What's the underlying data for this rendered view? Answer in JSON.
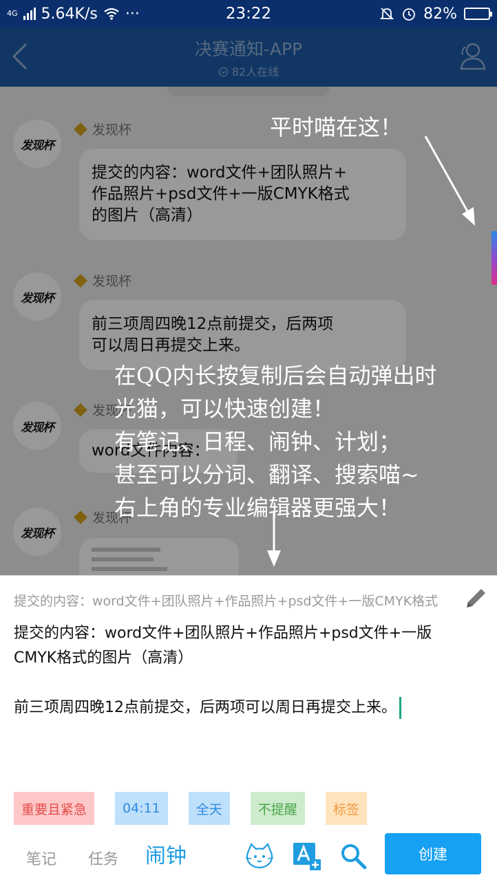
{
  "status_bar": {
    "network": "4G",
    "speed": "5.64K/s",
    "more": "···",
    "time": "23:22",
    "battery": "82%",
    "battery_level": 0.82
  },
  "header": {
    "title": "决赛通知-APP",
    "online": "82人在线"
  },
  "chat": {
    "messages": [
      {
        "sender": "发现杯",
        "avatar_text": "发现杯",
        "lines": [
          "提交的内容：word文件+团队照片+",
          "作品照片+psd文件+一版CMYK格式",
          "的图片（高清）"
        ]
      },
      {
        "sender": "发现杯",
        "avatar_text": "发现杯",
        "lines": [
          "前三项周四晚12点前提交，后两项",
          "可以周日再提交上来。"
        ]
      },
      {
        "sender": "发现杯",
        "avatar_text": "发现杯",
        "lines": [
          "word文件内容："
        ]
      },
      {
        "sender": "发现杯",
        "avatar_text": "发现杯",
        "lines": []
      }
    ]
  },
  "overlay": {
    "hint_top": "平时喵在这！",
    "hint_lines": [
      "在QQ内长按复制后会自动弹出时",
      "光猫，可以快速创建！",
      "有笔记、日程、闹钟、计划；",
      "甚至可以分词、翻译、搜索喵~",
      "右上角的专业编辑器更强大！"
    ]
  },
  "panel": {
    "preview": "提交的内容：word文件+团队照片+作品照片+psd文件+一版CMYK格式",
    "body_line1": "提交的内容：word文件+团队照片+作品照片+psd文件+一版",
    "body_line2": "CMYK格式的图片（高清）",
    "body_line3": "前三项周四晚12点前提交，后两项可以周日再提交上来。",
    "tags": {
      "priority": "重要且紧急",
      "time": "04:11",
      "allday": "全天",
      "reminder": "不提醒",
      "label": "标签"
    },
    "tabs": {
      "note": "笔记",
      "task": "任务",
      "alarm": "闹钟"
    },
    "create": "创建"
  }
}
